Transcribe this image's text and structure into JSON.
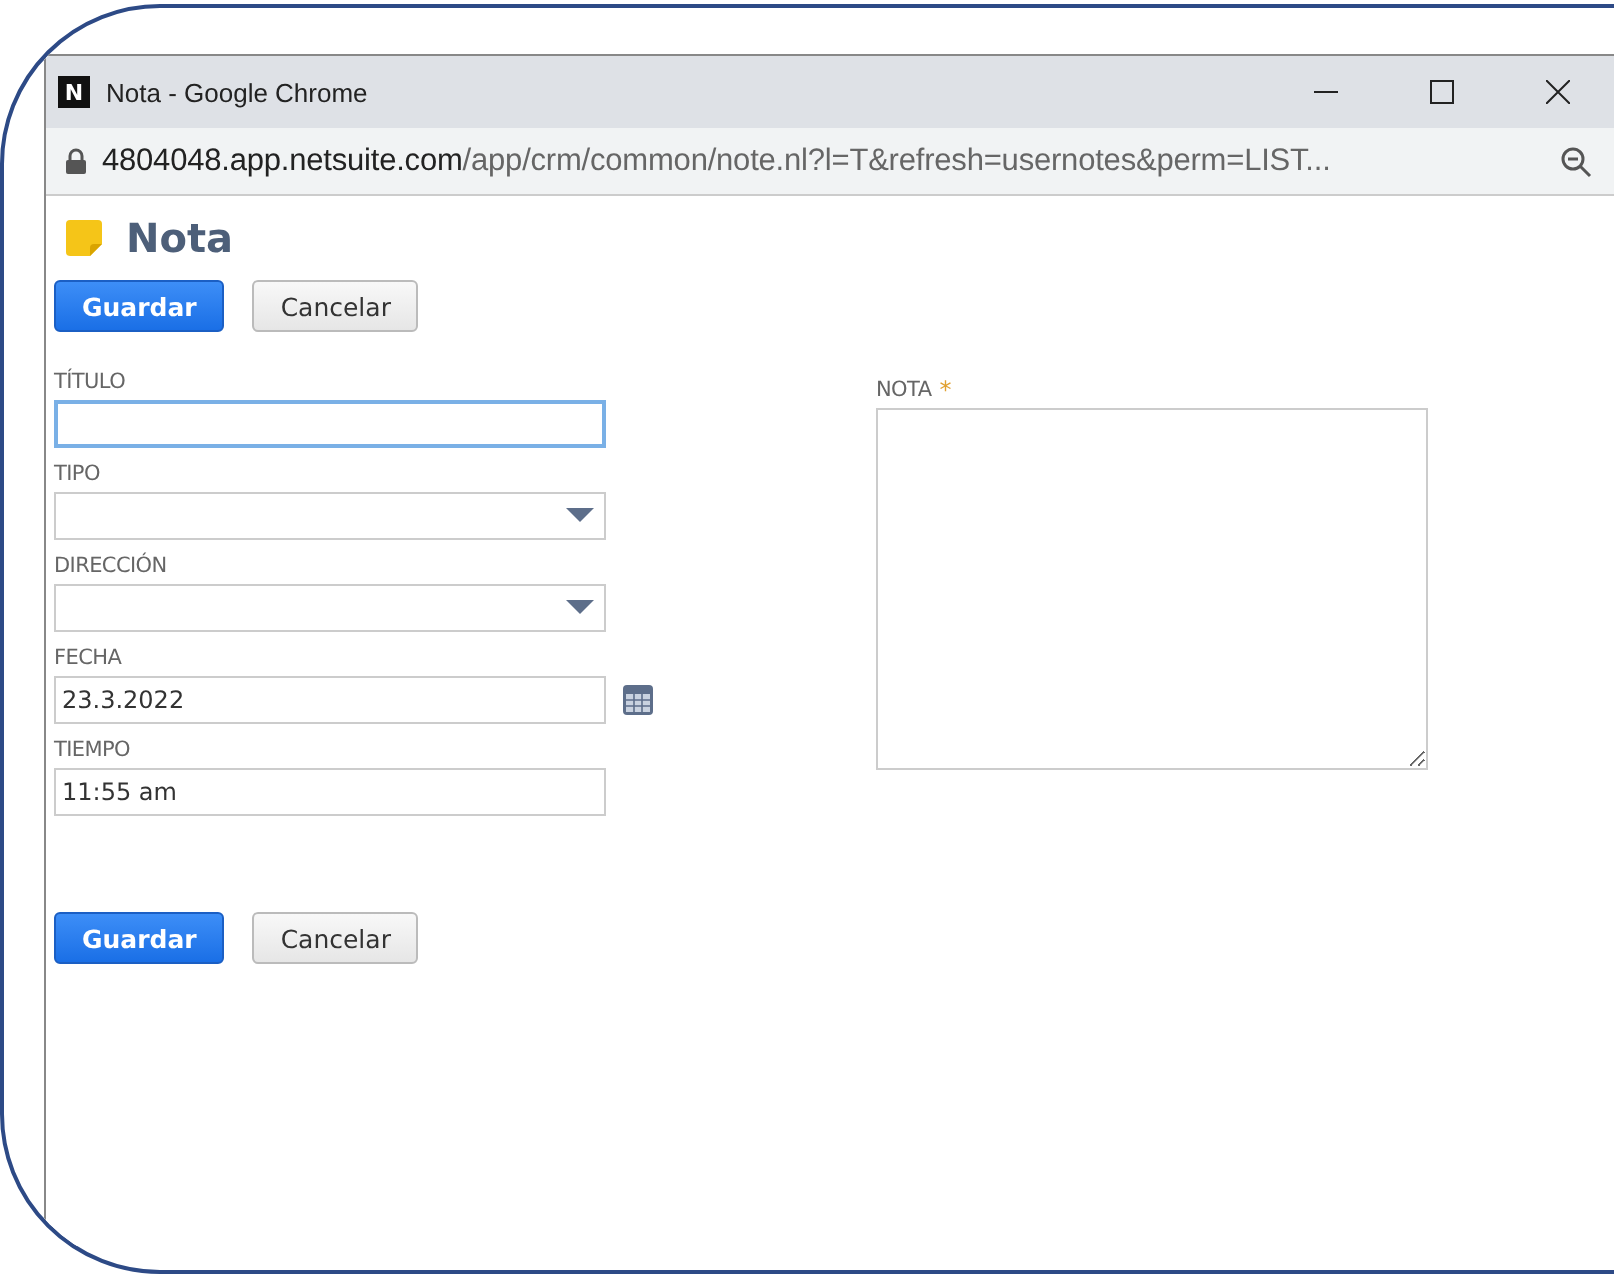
{
  "window": {
    "title": "Nota - Google Chrome",
    "logo": "N",
    "controls": [
      {
        "kind": "minimize"
      },
      {
        "kind": "maximize"
      },
      {
        "kind": "close"
      }
    ]
  },
  "address_bar": {
    "host": "4804048.app.netsuite.com",
    "path": "/app/crm/common/note.nl?l=T&refresh=usernotes&perm=LIST..."
  },
  "page": {
    "title": "Nota"
  },
  "top_buttons": [
    {
      "label": "Guardar",
      "kind": "primary"
    },
    {
      "label": "Cancelar",
      "kind": "secondary"
    }
  ],
  "fields": [
    {
      "label": "TÍTULO",
      "kind": "text",
      "focused": true
    },
    {
      "label": "TIPO",
      "kind": "select",
      "focused": false
    },
    {
      "label": "DIRECCIÓN",
      "kind": "select",
      "focused": false
    },
    {
      "label": "FECHA",
      "kind": "date",
      "value": "23.3.2022",
      "focused": false
    },
    {
      "label": "TIEMPO",
      "kind": "text",
      "value": "11:55 am",
      "focused": false
    }
  ],
  "note_field": {
    "label": "NOTA",
    "required_mark": "*"
  },
  "bottom_buttons": [
    {
      "label": "Guardar",
      "kind": "primary"
    },
    {
      "label": "Cancelar",
      "kind": "secondary"
    }
  ]
}
